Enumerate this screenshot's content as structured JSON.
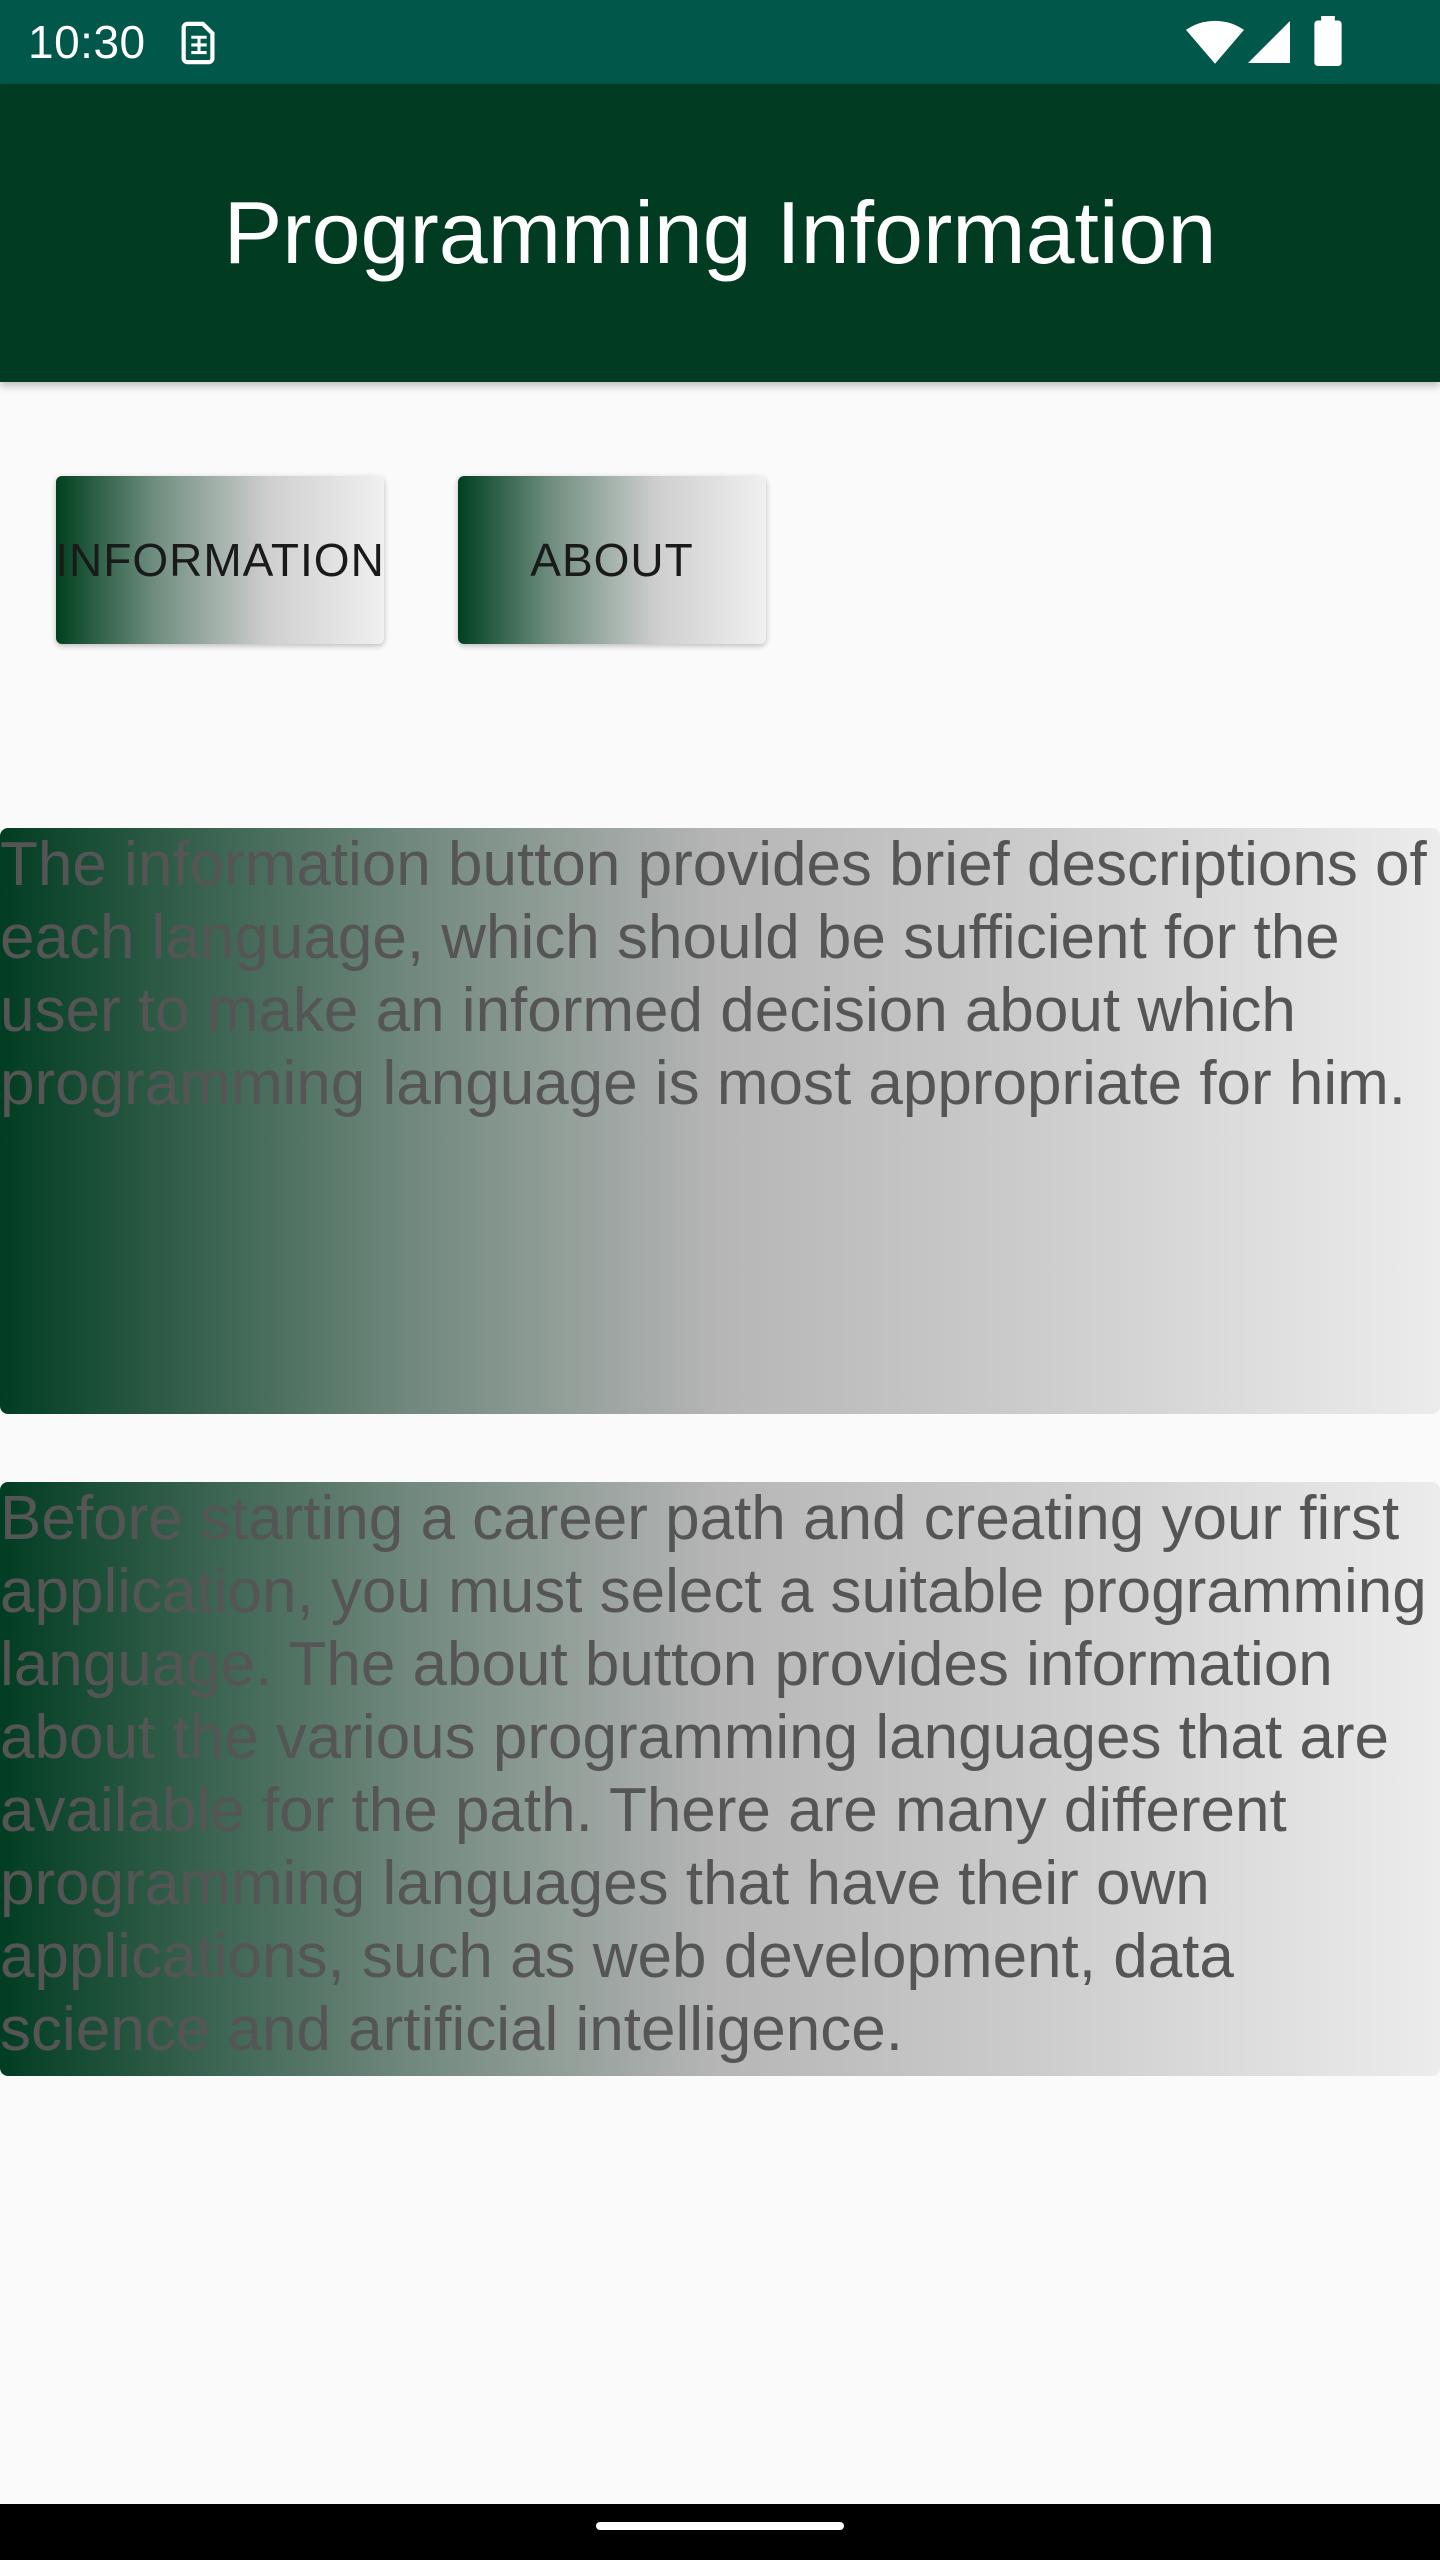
{
  "status_bar": {
    "time": "10:30",
    "background": "#01574a",
    "icons": [
      "sim-icon",
      "wifi-icon",
      "signal-icon",
      "battery-icon"
    ]
  },
  "app_bar": {
    "title": "Programming Information",
    "background": "#003b22"
  },
  "buttons": {
    "information_label": "INFORMATION",
    "about_label": "ABOUT"
  },
  "panels": {
    "information_text": "The information button provides brief descriptions of each language, which should be sufficient for the user to make an informed decision about which programming language is most appropriate for him.",
    "about_text": "Before starting a career path and creating your first application, you must select a suitable programming language. The about button provides information about the various programming languages that are available for the path. There are many different programming languages that have their own applications, such as web development, data science and artificial intelligence."
  },
  "colors": {
    "accent_dark_green": "#003b22",
    "gradient_light": "#f0f0f0",
    "body_text": "#555555"
  }
}
